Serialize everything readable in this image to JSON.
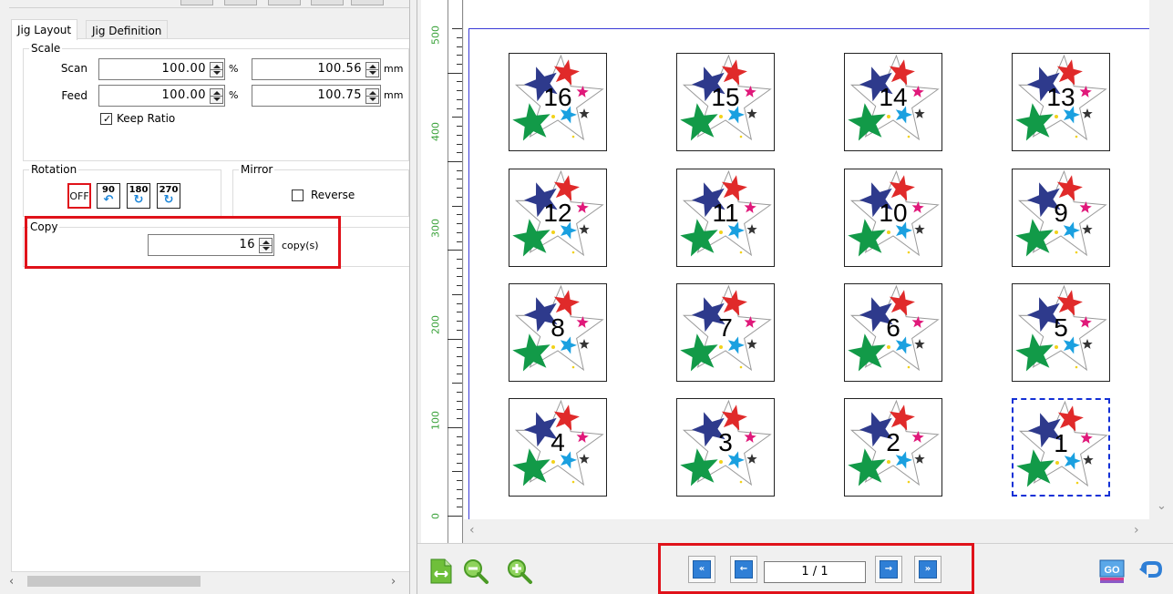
{
  "tabs": [
    {
      "label": "Jig Layout",
      "active": true
    },
    {
      "label": "Jig Definition",
      "active": false
    }
  ],
  "scale": {
    "title": "Scale",
    "scan_label": "Scan",
    "scan_percent": "100.00",
    "scan_mm": "100.56",
    "feed_label": "Feed",
    "feed_percent": "100.00",
    "feed_mm": "100.75",
    "percent_unit": "%",
    "mm_unit": "mm",
    "keep_ratio_label": "Keep Ratio",
    "keep_ratio_checked": true
  },
  "rotation": {
    "title": "Rotation",
    "off_label": "OFF",
    "deg90": "90",
    "deg180": "180",
    "deg270": "270",
    "selected": "OFF"
  },
  "mirror": {
    "title": "Mirror",
    "reverse_label": "Reverse",
    "reverse_checked": false
  },
  "copy": {
    "title": "Copy",
    "value": "16",
    "unit": "copy(s)"
  },
  "ruler": {
    "labels": [
      "500",
      "400",
      "300",
      "200",
      "100",
      "0"
    ],
    "label_color": "#3aa23a"
  },
  "layout": {
    "rows": [
      [
        "16",
        "15",
        "14",
        "13"
      ],
      [
        "12",
        "11",
        "10",
        "9"
      ],
      [
        "8",
        "7",
        "6",
        "5"
      ],
      [
        "4",
        "3",
        "2",
        "1"
      ]
    ],
    "selected": "1"
  },
  "pagination": {
    "page": "1 / 1"
  },
  "colors": {
    "highlight": "#e0121a",
    "accent": "#2f7fd6",
    "selection": "#1230d6",
    "star_navy": "#2e3a8c",
    "star_red": "#e02a2a",
    "star_green": "#129a48",
    "star_magenta": "#e0197a",
    "star_cyan": "#1aa0e0",
    "star_dark": "#333333"
  }
}
